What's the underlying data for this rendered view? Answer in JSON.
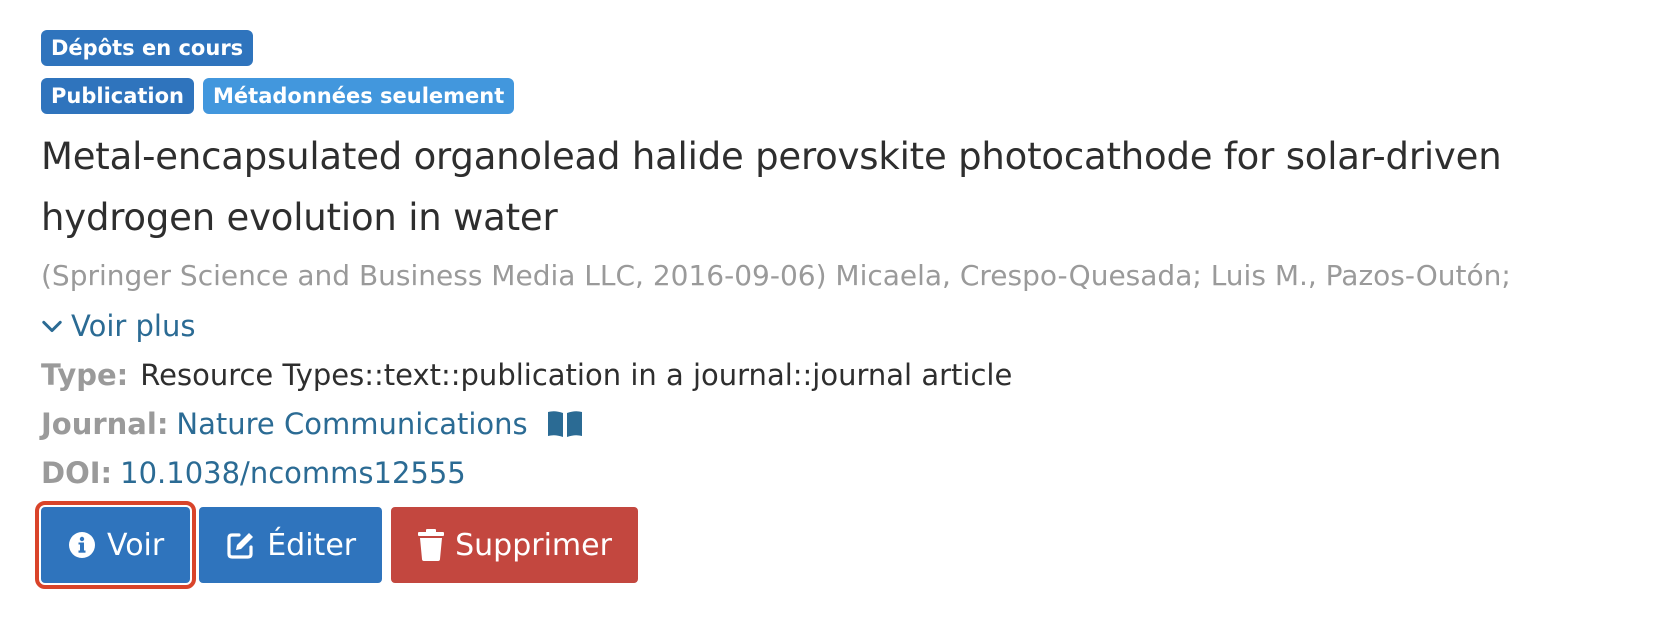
{
  "badges": {
    "row1": [
      "Dépôts en cours"
    ],
    "row2": [
      "Publication",
      "Métadonnées seulement"
    ]
  },
  "title": "Metal-encapsulated organolead halide perovskite photocathode for solar-driven hydrogen evolution in water",
  "citation": "(Springer Science and Business Media LLC, 2016-09-06) Micaela, Crespo-Quesada; Luis M., Pazos-Outón;",
  "see_more": "Voir plus",
  "fields": {
    "type_label": "Type:",
    "type_value": "Resource Types::text::publication in a journal::journal article",
    "journal_label": "Journal:",
    "journal_value": "Nature Communications",
    "doi_label": "DOI:",
    "doi_value": "10.1038/ncomms12555"
  },
  "buttons": {
    "view": "Voir",
    "edit": "Éditer",
    "delete": "Supprimer"
  },
  "colors": {
    "primary": "#2f74bd",
    "badge_light": "#4297dd",
    "danger": "#c3473f",
    "link": "#2b6b94",
    "highlight": "#d9442a"
  }
}
